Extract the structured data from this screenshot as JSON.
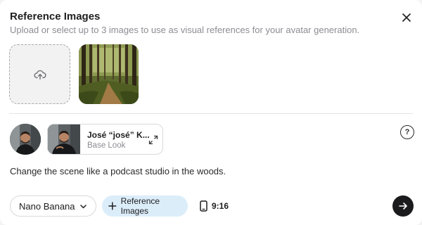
{
  "modal": {
    "title": "Reference Images",
    "subtitle": "Upload or select up to 3 images to use as visual references for your avatar generation."
  },
  "icons": {
    "close": "close-icon",
    "upload": "upload-cloud-icon",
    "expand": "expand-icon",
    "help": "help-icon",
    "chevron": "chevron-down-icon",
    "phone": "phone-icon",
    "arrow": "arrow-right-icon"
  },
  "avatar_look": {
    "name": "José “josé” K...",
    "subtitle": "Base Look"
  },
  "help_label": "?",
  "prompt_text": "Change the scene like a podcast studio in the woods.",
  "toolbar": {
    "model": "Nano Banana",
    "reference_button": "Reference Images",
    "aspect_ratio": "9:16"
  },
  "colors": {
    "accent_pill": "#dcedfa",
    "send_button": "#1b1b1d",
    "muted_text": "#8d8d93"
  }
}
